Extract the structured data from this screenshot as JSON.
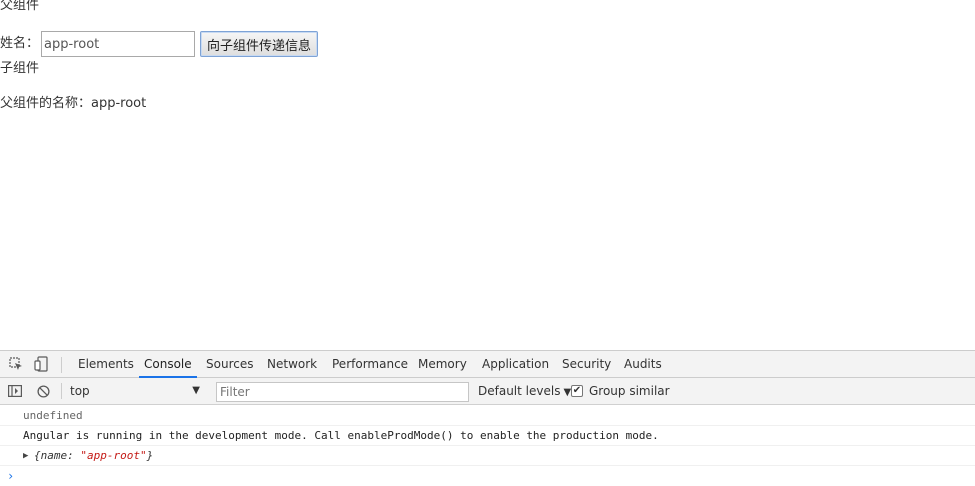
{
  "app": {
    "parent_title": "父组件",
    "name_label": "姓名：",
    "name_value": "app-root",
    "send_button": "向子组件传递信息",
    "child_title": "子组件",
    "child_info": "父组件的名称：app-root"
  },
  "devtools": {
    "tabs": [
      "Elements",
      "Console",
      "Sources",
      "Network",
      "Performance",
      "Memory",
      "Application",
      "Security",
      "Audits"
    ],
    "active_tab": "Console",
    "toolbar": {
      "context": "top",
      "filter_placeholder": "Filter",
      "levels": "Default levels",
      "group_similar": "Group similar",
      "group_similar_checked": true
    },
    "console_lines": {
      "line1": "undefined",
      "line2": "Angular is running in the development mode. Call enableProdMode() to enable the production mode.",
      "obj_prefix": "{name: ",
      "obj_value": "\"app-root\"",
      "obj_suffix": "}"
    },
    "accent_color": "#1a73e8"
  }
}
